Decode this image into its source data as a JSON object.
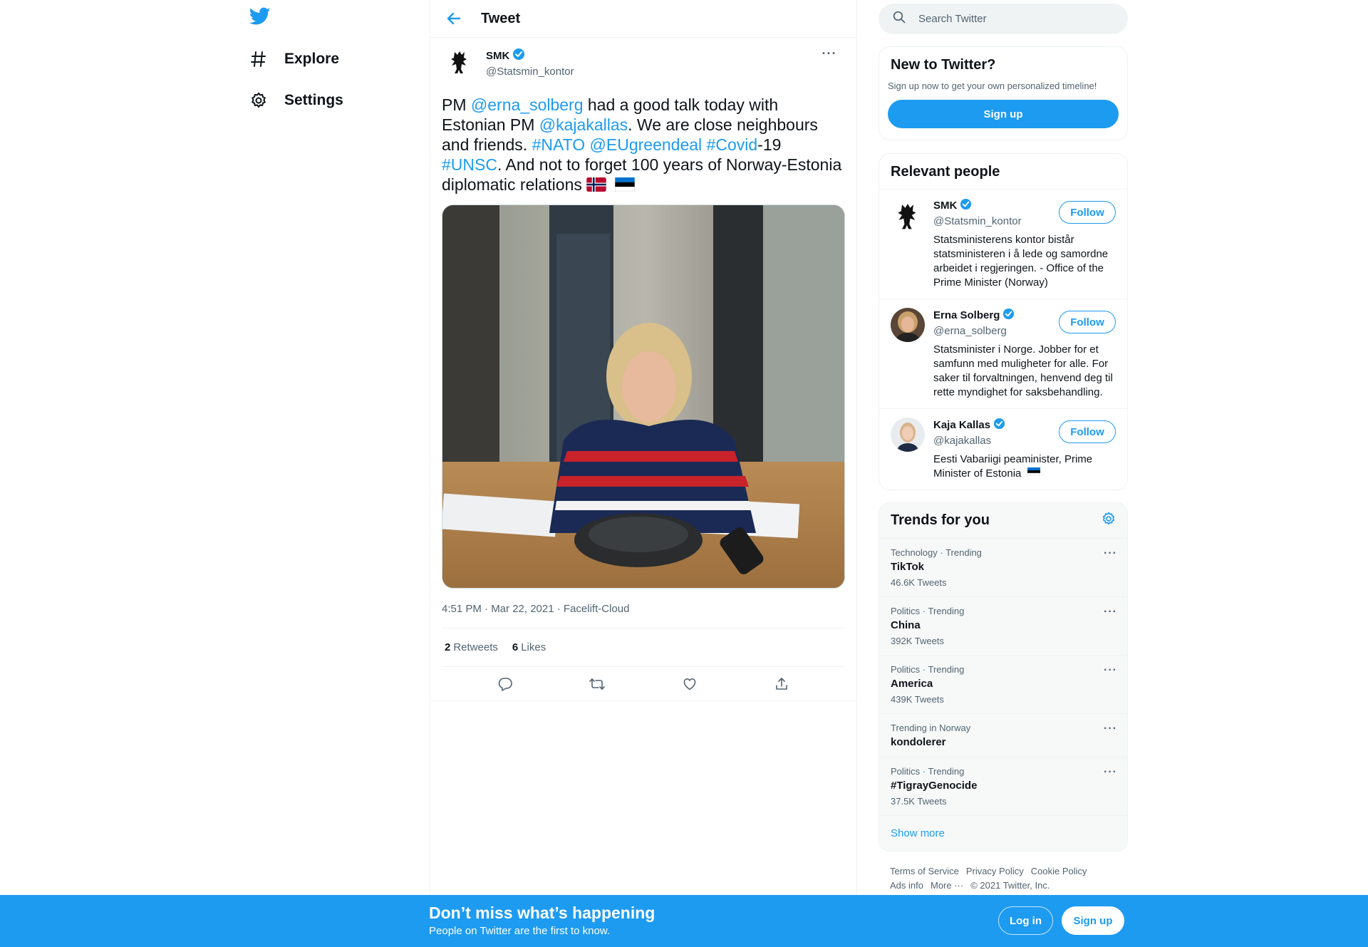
{
  "colors": {
    "accent": "#1d9bf0",
    "text": "#0f1419",
    "muted": "#536471",
    "border": "#eff3f4"
  },
  "nav": {
    "logo_icon": "twitter-bird-icon",
    "items": [
      {
        "label": "Explore",
        "icon": "hashtag-icon"
      },
      {
        "label": "Settings",
        "icon": "gear-icon"
      }
    ]
  },
  "header": {
    "title": "Tweet"
  },
  "tweet": {
    "author_name": "SMK",
    "author_handle": "@Statsmin_kontor",
    "text_parts": [
      {
        "t": "PM "
      },
      {
        "t": "@erna_solberg",
        "link": true
      },
      {
        "t": " had a good talk today with Estonian PM "
      },
      {
        "t": "@kajakallas",
        "link": true
      },
      {
        "t": ". We are close neighbours and friends. "
      },
      {
        "t": "#NATO",
        "link": true
      },
      {
        "t": " "
      },
      {
        "t": "@EUgreendeal",
        "link": true
      },
      {
        "t": " "
      },
      {
        "t": "#Covid",
        "link": true
      },
      {
        "t": "-19 "
      },
      {
        "t": "#UNSC",
        "link": true
      },
      {
        "t": ". And not to forget 100 years of Norway-Estonia diplomatic relations"
      }
    ],
    "flags": [
      "norway-flag-icon",
      "estonia-flag-icon"
    ],
    "meta": "4:51 PM · Mar 22, 2021 · Facelift-Cloud",
    "retweets": "2",
    "retweets_label": "Retweets",
    "likes": "6",
    "likes_label": "Likes"
  },
  "search": {
    "placeholder": "Search Twitter"
  },
  "new_to_twitter": {
    "title": "New to Twitter?",
    "subtitle": "Sign up now to get your own personalized timeline!",
    "button": "Sign up"
  },
  "relevant_people": {
    "title": "Relevant people",
    "follow_label": "Follow",
    "people": [
      {
        "name": "SMK",
        "handle": "@Statsmin_kontor",
        "bio": "Statsministerens kontor bistår statsministeren i å lede og samordne arbeidet i regjeringen. - Office of the Prime Minister (Norway)"
      },
      {
        "name": "Erna Solberg",
        "handle": "@erna_solberg",
        "bio": "Statsminister i Norge. Jobber for et samfunn med muligheter for alle. For saker til forvaltningen, henvend deg til rette myndighet for saksbehandling."
      },
      {
        "name": "Kaja Kallas",
        "handle": "@kajakallas",
        "bio": "Eesti Vabariigi peaminister, Prime Minister of Estonia"
      }
    ]
  },
  "trends": {
    "title": "Trends for you",
    "items": [
      {
        "category": "Technology · Trending",
        "name": "TikTok",
        "count": "46.6K Tweets"
      },
      {
        "category": "Politics · Trending",
        "name": "China",
        "count": "392K Tweets"
      },
      {
        "category": "Politics · Trending",
        "name": "America",
        "count": "439K Tweets"
      },
      {
        "category": "Trending in Norway",
        "name": "kondolerer",
        "count": ""
      },
      {
        "category": "Politics · Trending",
        "name": "#TigrayGenocide",
        "count": "37.5K Tweets"
      }
    ],
    "show_more": "Show more"
  },
  "footer": {
    "links": [
      "Terms of Service",
      "Privacy Policy",
      "Cookie Policy",
      "Ads info",
      "More ···"
    ],
    "copyright": "© 2021 Twitter, Inc."
  },
  "bottom_bar": {
    "title": "Don’t miss what’s happening",
    "subtitle": "People on Twitter are the first to know.",
    "login": "Log in",
    "signup": "Sign up"
  }
}
